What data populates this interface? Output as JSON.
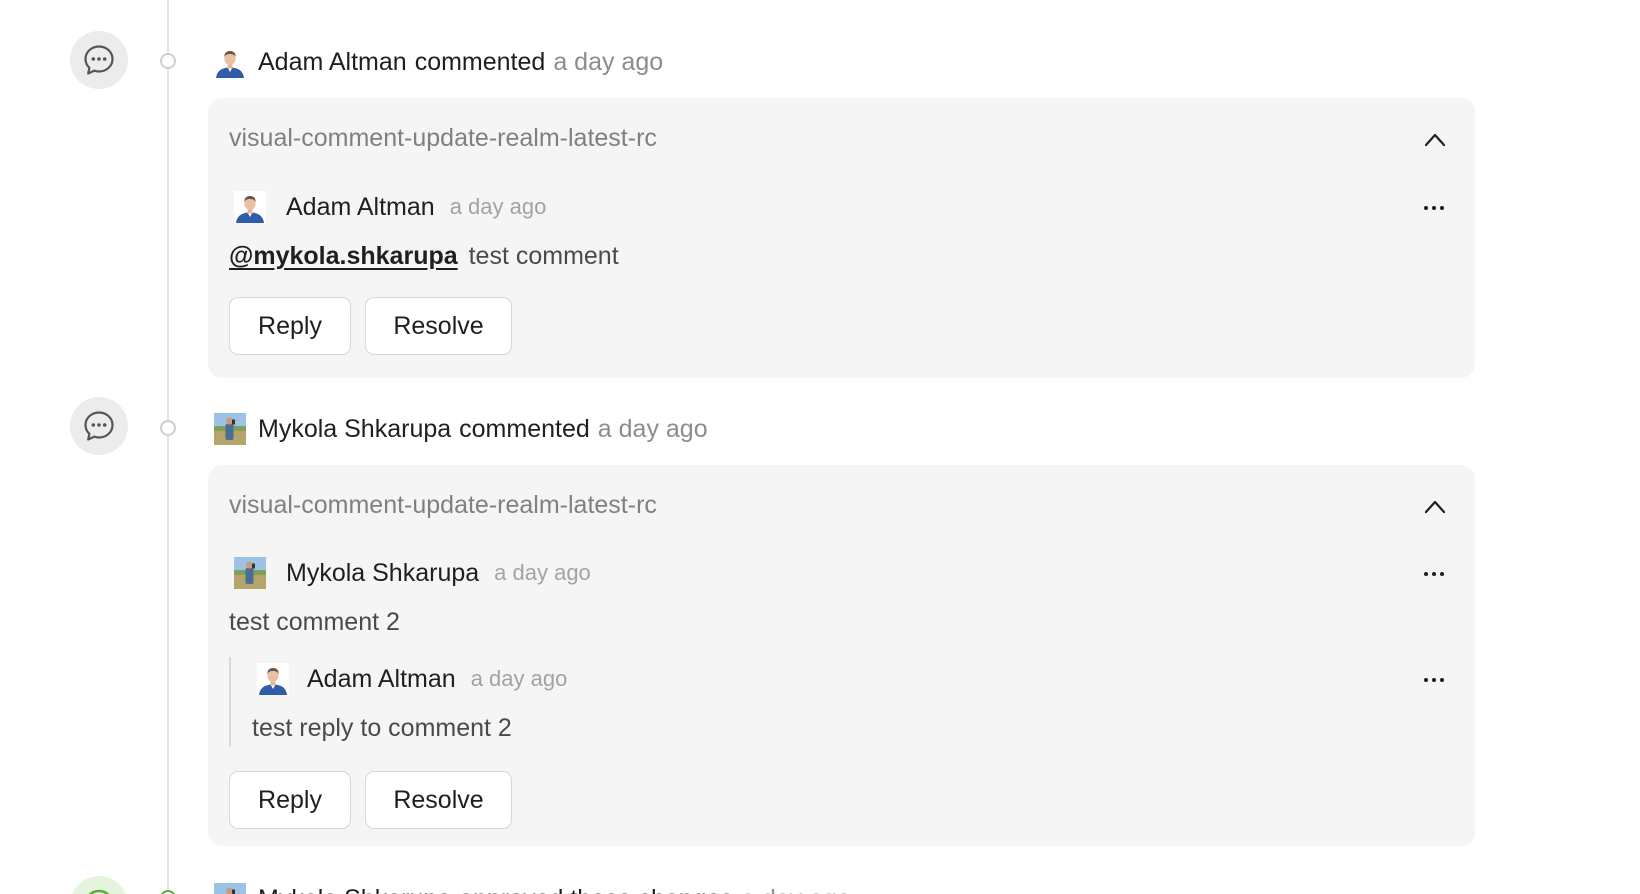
{
  "events": [
    {
      "actor": "Adam Altman",
      "action": "commented",
      "time": "a day ago",
      "card": {
        "branch": "visual-comment-update-realm-latest-rc",
        "comment": {
          "author": "Adam Altman",
          "time": "a day ago",
          "mention": "@mykola.shkarupa",
          "text": "test comment"
        },
        "reply_label": "Reply",
        "resolve_label": "Resolve"
      }
    },
    {
      "actor": "Mykola Shkarupa",
      "action": "commented",
      "time": "a day ago",
      "card": {
        "branch": "visual-comment-update-realm-latest-rc",
        "comment": {
          "author": "Mykola Shkarupa",
          "time": "a day ago",
          "text": "test comment 2"
        },
        "reply": {
          "author": "Adam Altman",
          "time": "a day ago",
          "text": "test reply to comment 2"
        },
        "reply_label": "Reply",
        "resolve_label": "Resolve"
      }
    },
    {
      "actor": "Mykola Shkarupa",
      "action": "approved these changes",
      "time": "a day ago"
    }
  ],
  "icons": {
    "comment_event": "speech-bubble-icon",
    "approved_event": "check-circle-icon",
    "collapse": "chevron-up-icon",
    "more": "more-horizontal-icon"
  },
  "colors": {
    "card_background": "#f5f5f5",
    "muted_text": "#8c8c8c",
    "approved_green": "#58b02f"
  }
}
